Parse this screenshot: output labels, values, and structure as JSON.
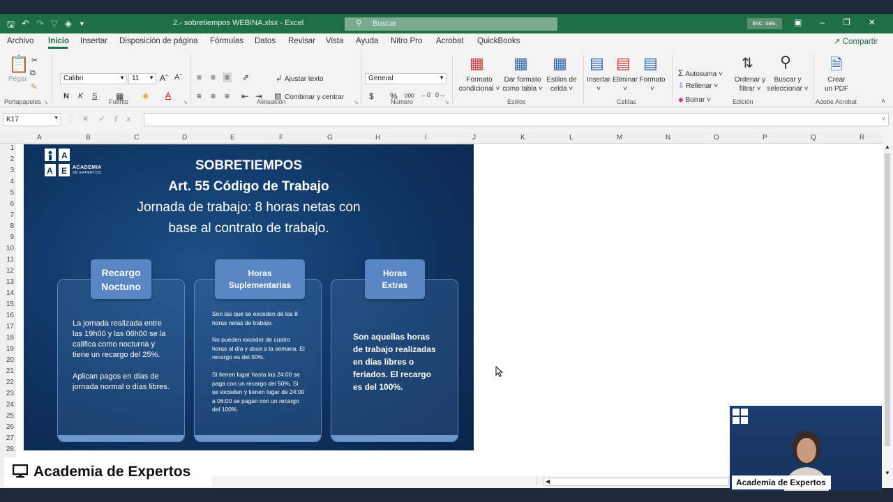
{
  "titlebar": {
    "title": "2.- sobretiempos WEBINA.xlsx  -  Excel",
    "search_placeholder": "Buscar",
    "signin": "Inic. ses."
  },
  "menu": [
    "Archivo",
    "Inicio",
    "Insertar",
    "Disposición de página",
    "Fórmulas",
    "Datos",
    "Revisar",
    "Vista",
    "Ayuda",
    "Nitro Pro",
    "Acrobat",
    "QuickBooks"
  ],
  "share": "Compartir",
  "ribbon": {
    "paste": "Pegar",
    "font_name": "Calibri",
    "font_size": "11",
    "wrap": "Ajustar texto",
    "merge": "Combinar y centrar",
    "number_format": "General",
    "cond_format_1": "Formato",
    "cond_format_2": "condicional",
    "table_format_1": "Dar formato",
    "table_format_2": "como tabla",
    "cell_styles_1": "Estilos de",
    "cell_styles_2": "celda",
    "insert": "Insertar",
    "delete": "Eliminar",
    "format": "Formato",
    "autosum": "Autosuma",
    "fill": "Rellenar",
    "clear": "Borrar",
    "sort_1": "Ordenar y",
    "sort_2": "filtrar",
    "find_1": "Buscar y",
    "find_2": "seleccionar",
    "pdf_1": "Crear",
    "pdf_2": "un PDF",
    "groups": {
      "clipboard": "Portapapeles",
      "font": "Fuente",
      "alignment": "Alineación",
      "number": "Número",
      "styles": "Estilos",
      "cells": "Celdas",
      "editing": "Edición",
      "acrobat": "Adobe Acrobat"
    }
  },
  "namebox": "K17",
  "columns": [
    "A",
    "B",
    "C",
    "D",
    "E",
    "F",
    "G",
    "H",
    "I",
    "J",
    "K",
    "L",
    "M",
    "N",
    "O",
    "P",
    "Q",
    "R"
  ],
  "rows": [
    "1",
    "2",
    "3",
    "4",
    "5",
    "6",
    "7",
    "8",
    "9",
    "10",
    "11",
    "12",
    "13",
    "14",
    "15",
    "16",
    "17",
    "18",
    "19",
    "20",
    "21",
    "22",
    "23",
    "24",
    "25",
    "26",
    "27",
    "28"
  ],
  "slide": {
    "logo_line1": "ACADEMIA",
    "logo_line2": "DE EXPERTOS",
    "title1": "SOBRETIEMPOS",
    "title2": "Art. 55 Código de Trabajo",
    "subtitle1": "Jornada de trabajo: 8 horas netas con",
    "subtitle2": "base al contrato de trabajo.",
    "cards": [
      {
        "tab1": "Recargo",
        "tab2": "Noctuno",
        "p1": "La jornada realizada entre las 19h00 y las 06h00 se la califica como nocturna y tiene un recargo del 25%.",
        "p2": "Aplican pagos en días de jornada normal o días libres."
      },
      {
        "tab1": "Horas",
        "tab2": "Suplementarias",
        "p1": "Son las que se exceden de las 8 horas netas de trabajo.",
        "p2": "No pueden exceder de cuatro horas al día y doce a la semana. El recargo es del 50%.",
        "p3": "Si tienen lugar hasta las 24:00 se paga con un recargo del 50%. Si se exceden y tienen lugar de 24:00 a 06:00 se pagan con un recargo del 100%."
      },
      {
        "tab1": "Horas",
        "tab2": "Extras",
        "p1": "Son aquellas horas de trabajo realizadas en días libres o feriados. El recargo es del 100%."
      }
    ]
  },
  "banner": "Academia de Expertos",
  "camera_label": "Academia de Expertos"
}
